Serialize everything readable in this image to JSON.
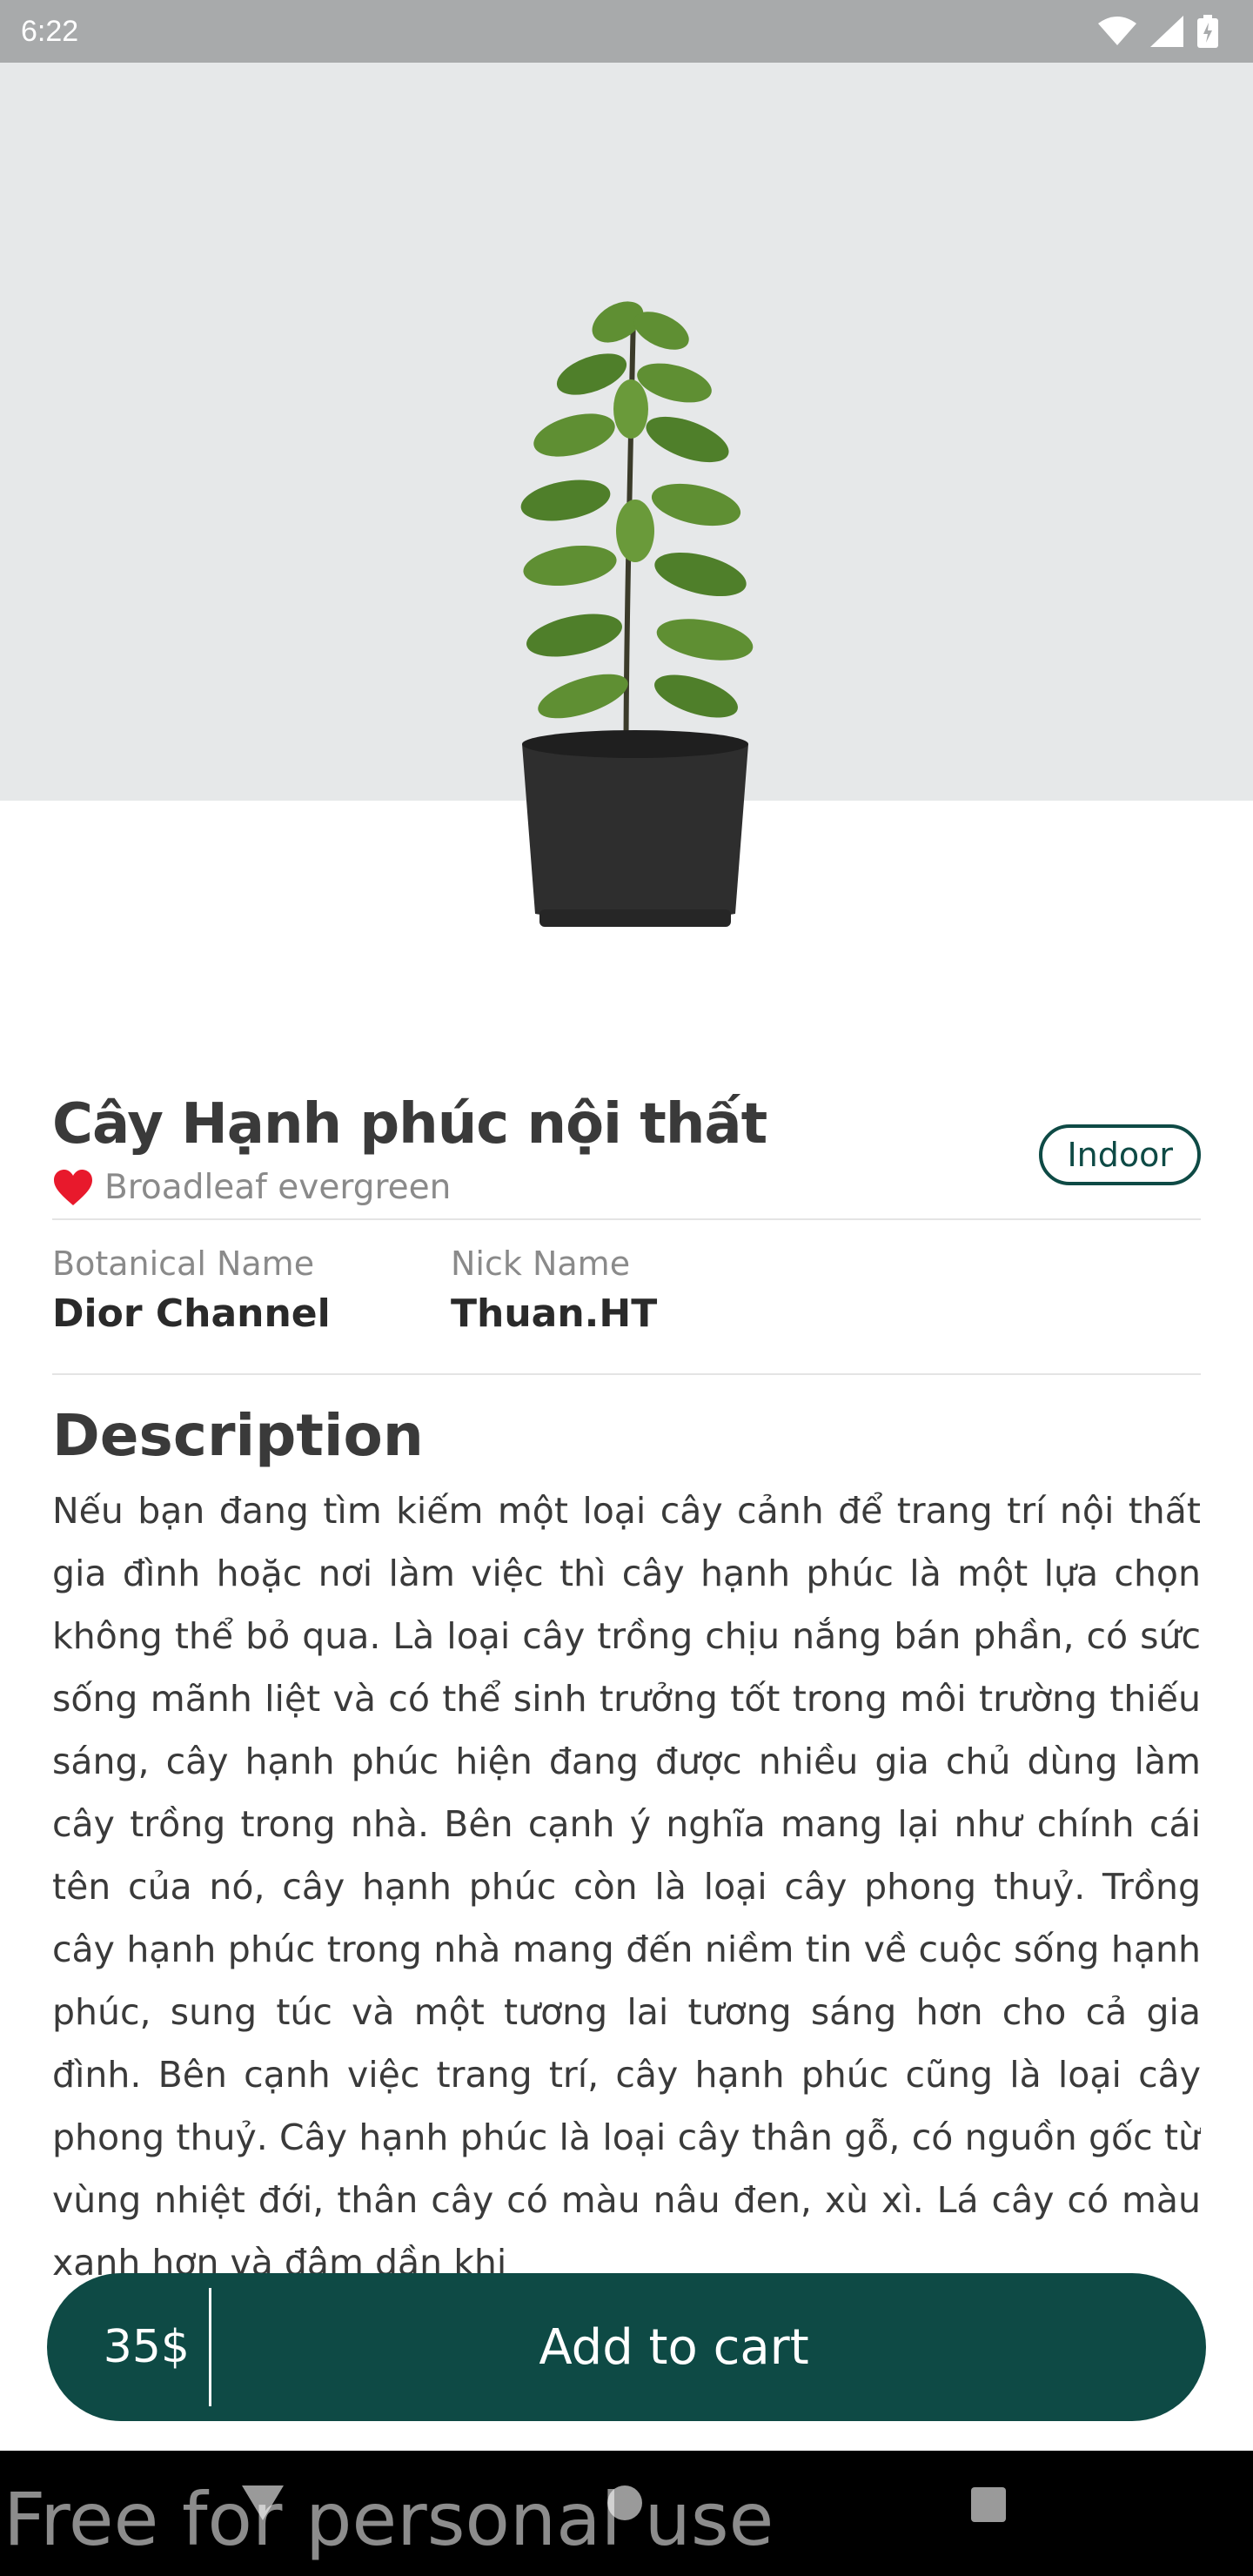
{
  "status_bar": {
    "time": "6:22",
    "icons": [
      "wifi-icon",
      "signal-icon",
      "battery-icon"
    ]
  },
  "product": {
    "title": "Cây Hạnh phúc nội thất",
    "subtitle": "Broadleaf evergreen",
    "category_chip": "Indoor",
    "botanical_label": "Botanical Name",
    "botanical_value": "Dior Channel",
    "nick_label": "Nick Name",
    "nick_value": "Thuan.HT"
  },
  "description": {
    "heading": "Description",
    "body": "Nếu bạn đang tìm kiếm một loại cây cảnh để trang trí nội thất gia đình hoặc nơi làm việc thì cây hạnh phúc là một lựa chọn không thể bỏ qua. Là loại cây trồng chịu nắng bán phần, có sức sống mãnh liệt và có thể sinh trưởng tốt trong môi trường thiếu sáng, cây hạnh phúc hiện đang được nhiều gia chủ dùng làm cây trồng trong nhà. Bên cạnh ý nghĩa mang lại như chính cái tên của nó, cây hạnh phúc còn là loại cây phong thuỷ. Trồng cây hạnh phúc trong nhà mang đến niềm tin về cuộc sống hạnh phúc, sung túc và một tương lai tương sáng hơn cho cả gia đình. Bên cạnh việc trang trí, cây hạnh phúc cũng là loại cây phong thuỷ. Cây hạnh phúc là loại cây thân gỗ, có nguồn gốc từ vùng nhiệt đới, thân cây có màu nâu đen, xù xì. Lá cây có màu xanh hơn và đậm dần khi"
  },
  "cart": {
    "price": "35$",
    "button_label": "Add to cart"
  },
  "watermark": "Free for personal use",
  "colors": {
    "primary": "#0e4a45",
    "hero_bg": "#e6e8e9",
    "heart": "#e8192c"
  }
}
